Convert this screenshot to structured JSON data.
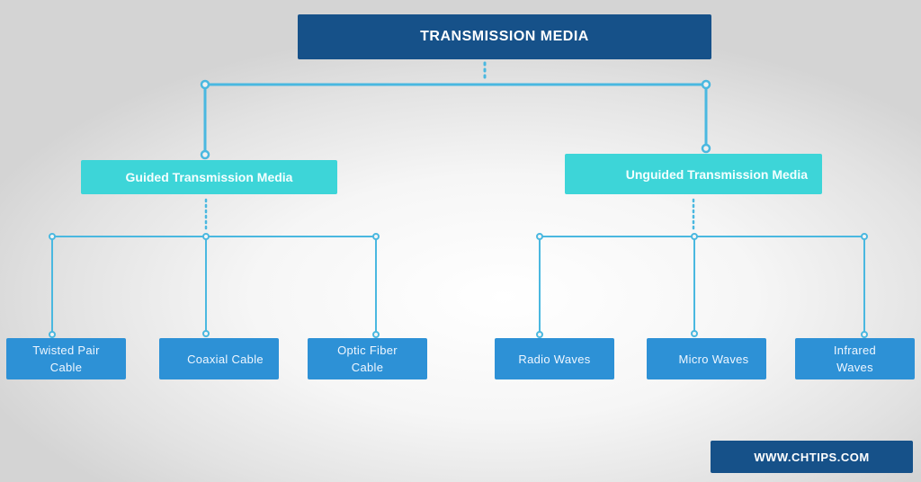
{
  "diagram": {
    "root": {
      "label": "TRANSMISSION MEDIA"
    },
    "categories": [
      {
        "label": "Guided Transmission Media",
        "children": [
          {
            "label": "Twisted Pair Cable"
          },
          {
            "label": "Coaxial Cable"
          },
          {
            "label": "Optic Fiber Cable"
          }
        ]
      },
      {
        "label": "Unguided Transmission Media",
        "children": [
          {
            "label": "Radio Waves"
          },
          {
            "label": "Micro Waves"
          },
          {
            "label": "Infrared Waves"
          }
        ]
      }
    ]
  },
  "footer": {
    "website": "WWW.CHTIPS.COM"
  },
  "colors": {
    "root": "#165189",
    "category": "#3dd5d8",
    "leaf": "#2d91d6",
    "connector": "#4ab8e0"
  }
}
